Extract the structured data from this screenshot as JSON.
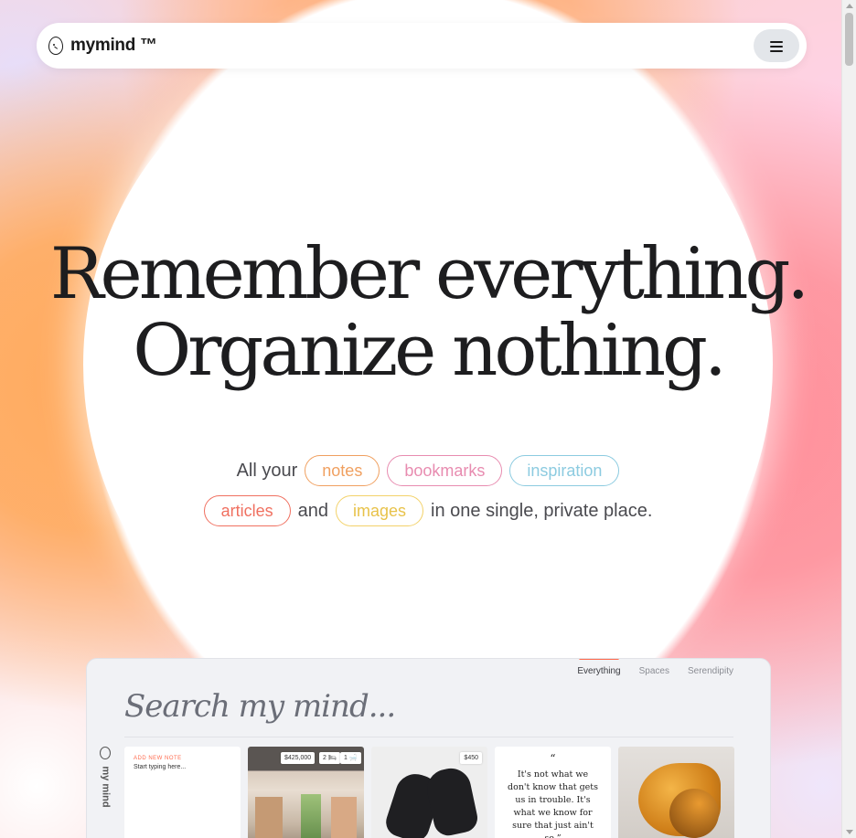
{
  "brand": {
    "name": "mymind ™"
  },
  "hero": {
    "line1": "Remember everything.",
    "line2": "Organize nothing."
  },
  "tagline": {
    "prefix": "All your",
    "pills": [
      {
        "label": "notes",
        "color": "#f0a060"
      },
      {
        "label": "bookmarks",
        "color": "#e88cb0"
      },
      {
        "label": "inspiration",
        "color": "#8ccbe0"
      },
      {
        "label": "articles",
        "color": "#f07060"
      },
      {
        "label": "images",
        "color": "#f3d26a"
      }
    ],
    "and": "and",
    "suffix": "in one single, private place."
  },
  "app": {
    "tabs": [
      "Everything",
      "Spaces",
      "Serendipity"
    ],
    "active_tab": "Everything",
    "search_placeholder": "Search my mind...",
    "side_label": "my mind",
    "note": {
      "label": "ADD NEW NOTE",
      "placeholder": "Start typing here..."
    },
    "kitchen_badges": [
      "$425,000",
      "2 🛏",
      "1 🛁"
    ],
    "shoes_badge": "$450",
    "quote": {
      "mark": "“",
      "text": "It's not what we don't know that gets us in trouble. It's what we know for sure that just ain't so.”"
    }
  },
  "colors": {
    "accent": "#ff6a4d"
  }
}
